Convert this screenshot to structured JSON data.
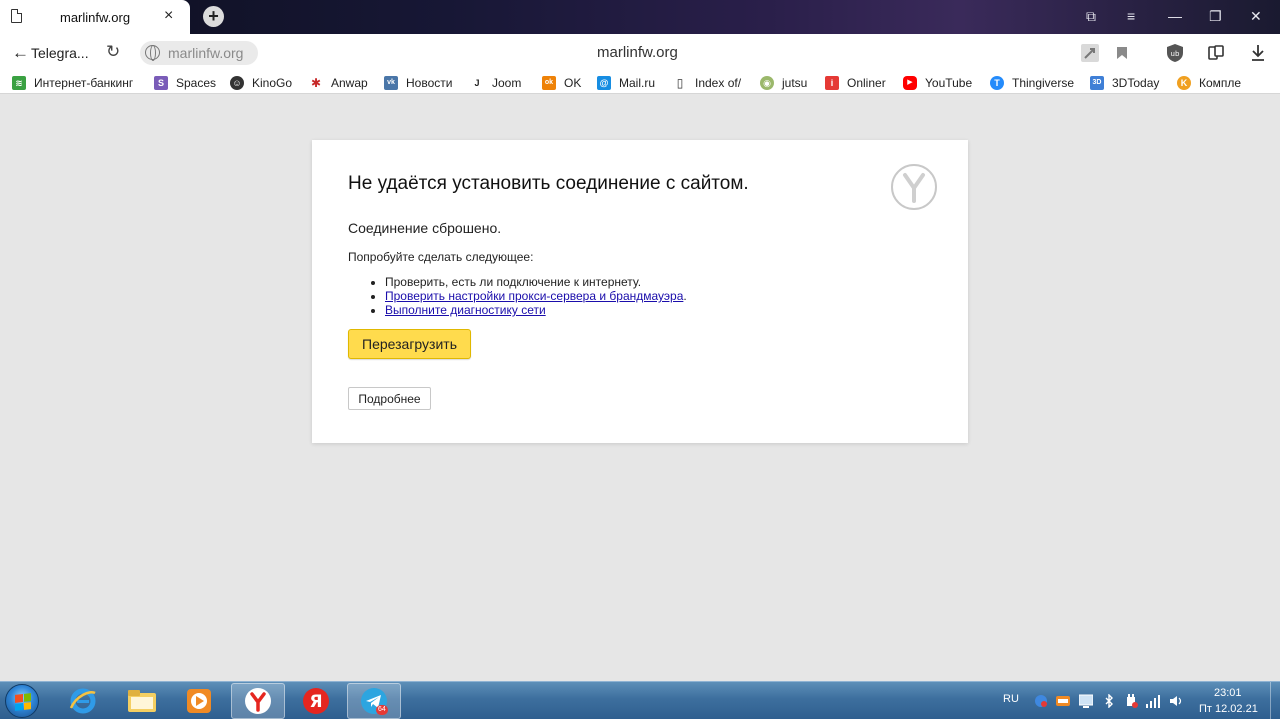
{
  "window": {
    "tab_title": "marlinfw.org",
    "tab_close": "×",
    "new_tab": "+",
    "controls": [
      "⧉",
      "≡",
      "—",
      "❐",
      "✕"
    ]
  },
  "navbar": {
    "back_label": "Telegra...",
    "address": "marlinfw.org",
    "page_title": "marlinfw.org"
  },
  "bookmarks": [
    {
      "label": "Интернет-банкинг",
      "icon": "bank-icon",
      "color": "#3aa142",
      "glyph": "≋"
    },
    {
      "label": "Spaces",
      "icon": "spaces-icon",
      "color": "#7a5cb8",
      "glyph": "S"
    },
    {
      "label": "KinoGo",
      "icon": "kinogo-icon",
      "color": "#333333",
      "glyph": "☺"
    },
    {
      "label": "Anwap",
      "icon": "anwap-icon",
      "color": "#c62828",
      "glyph": "✱"
    },
    {
      "label": "Новости",
      "icon": "vk-icon",
      "color": "#4a76a8",
      "glyph": "vk"
    },
    {
      "label": "Joom",
      "icon": "joom-icon",
      "color": "#ffffff",
      "glyph": "J"
    },
    {
      "label": "OK",
      "icon": "ok-icon",
      "color": "#ee8208",
      "glyph": "ok"
    },
    {
      "label": "Mail.ru",
      "icon": "mailru-icon",
      "color": "#168de2",
      "glyph": "@"
    },
    {
      "label": "Index of/",
      "icon": "page-icon",
      "color": "#ffffff",
      "glyph": "▯"
    },
    {
      "label": "jutsu",
      "icon": "jutsu-icon",
      "color": "#9bb86b",
      "glyph": "◉"
    },
    {
      "label": "Onliner",
      "icon": "onliner-icon",
      "color": "#e53935",
      "glyph": "i"
    },
    {
      "label": "YouTube",
      "icon": "youtube-icon",
      "color": "#ff0000",
      "glyph": "▶"
    },
    {
      "label": "Thingiverse",
      "icon": "thingiverse-icon",
      "color": "#248bfb",
      "glyph": "T"
    },
    {
      "label": "3DToday",
      "icon": "3dtoday-icon",
      "color": "#3f7fd6",
      "glyph": "3D"
    },
    {
      "label": "Компле",
      "icon": "komple-icon",
      "color": "#f0a020",
      "glyph": "K"
    }
  ],
  "error": {
    "title": "Не удаётся установить соединение с сайтом.",
    "lead": "Соединение сброшено.",
    "try": "Попробуйте сделать следующее:",
    "items": [
      {
        "text": "Проверить, есть ли подключение к интернету.",
        "link": false
      },
      {
        "text": "Проверить настройки прокси-сервера и брандмауэра",
        "link": true,
        "suffix": "."
      },
      {
        "text": "Выполните диагностику сети",
        "link": true,
        "suffix": ""
      }
    ],
    "reload_label": "Перезагрузить",
    "details_label": "Подробнее"
  },
  "taskbar": {
    "language": "RU",
    "time": "23:01",
    "date": "Пт 12.02.21",
    "telegram_badge": "64"
  },
  "colors": {
    "accent_button": "#ffdb4d",
    "link": "#1a0dab",
    "page_bg": "#e6e6e6"
  }
}
